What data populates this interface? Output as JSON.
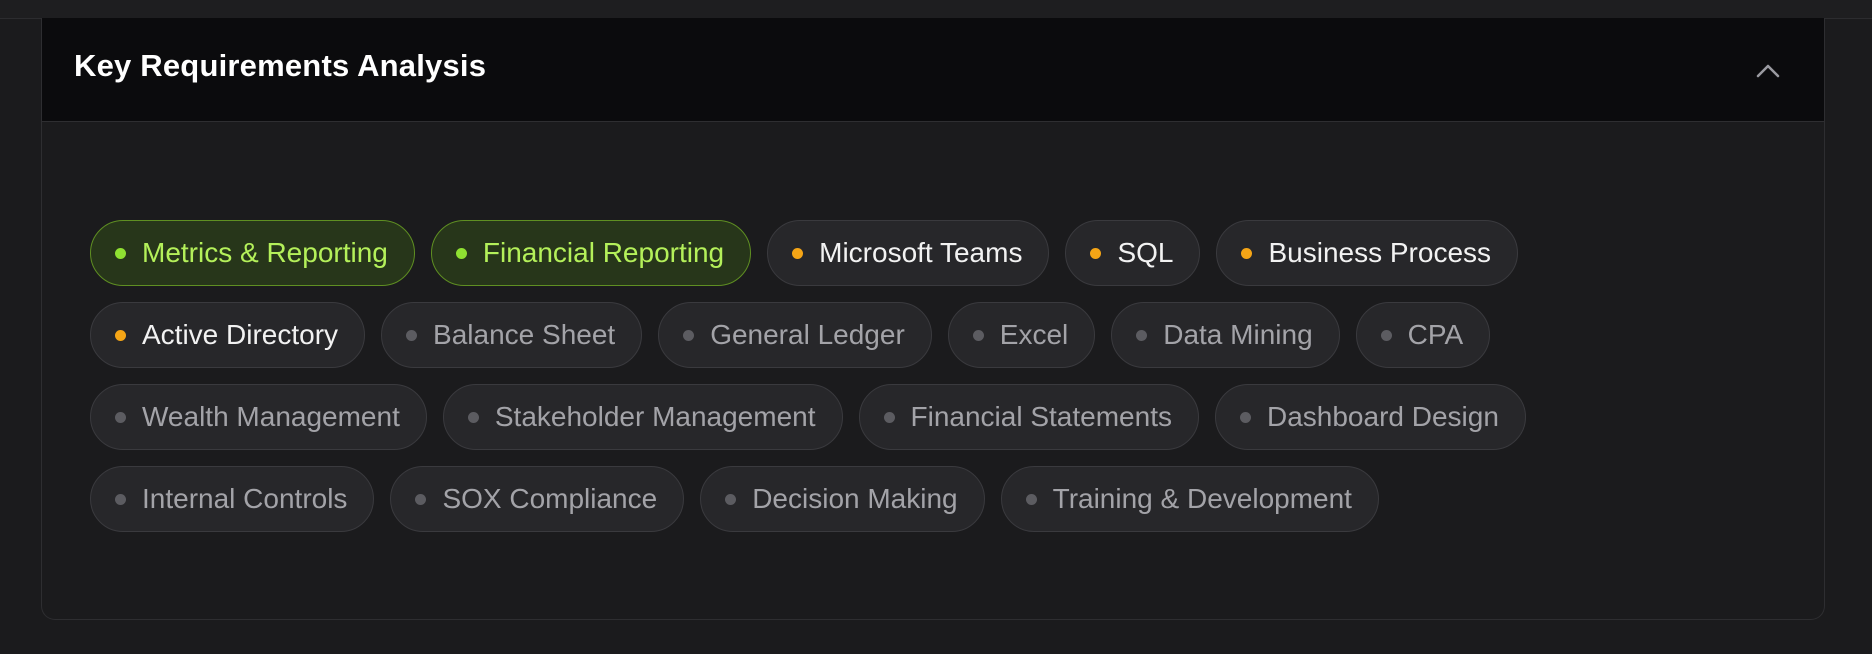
{
  "section": {
    "title": "Key Requirements Analysis"
  },
  "colors": {
    "matched": "#8fe032",
    "partial": "#f5a516",
    "missing": "#5c5c61"
  },
  "tags": [
    {
      "label": "Metrics & Reporting",
      "status": "match"
    },
    {
      "label": "Financial Reporting",
      "status": "match"
    },
    {
      "label": "Microsoft Teams",
      "status": "partial"
    },
    {
      "label": "SQL",
      "status": "partial"
    },
    {
      "label": "Business Process",
      "status": "partial"
    },
    {
      "label": "Active Directory",
      "status": "partial"
    },
    {
      "label": "Balance Sheet",
      "status": "missing"
    },
    {
      "label": "General Ledger",
      "status": "missing"
    },
    {
      "label": "Excel",
      "status": "missing"
    },
    {
      "label": "Data Mining",
      "status": "missing"
    },
    {
      "label": "CPA",
      "status": "missing"
    },
    {
      "label": "Wealth Management",
      "status": "missing"
    },
    {
      "label": "Stakeholder Management",
      "status": "missing"
    },
    {
      "label": "Financial Statements",
      "status": "missing"
    },
    {
      "label": "Dashboard Design",
      "status": "missing"
    },
    {
      "label": "Internal Controls",
      "status": "missing"
    },
    {
      "label": "SOX Compliance",
      "status": "missing"
    },
    {
      "label": "Decision Making",
      "status": "missing"
    },
    {
      "label": "Training & Development",
      "status": "missing"
    }
  ]
}
